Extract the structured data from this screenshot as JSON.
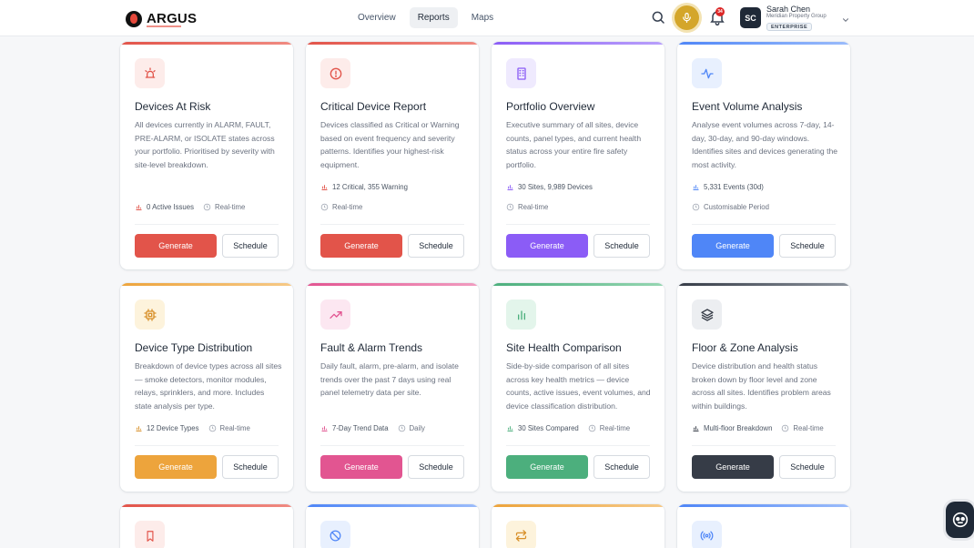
{
  "header": {
    "logo_text": "ARGUS",
    "nav": [
      {
        "label": "Overview",
        "active": false
      },
      {
        "label": "Reports",
        "active": true
      },
      {
        "label": "Maps",
        "active": false
      }
    ],
    "notifications_count": "34",
    "user": {
      "initials": "SC",
      "name": "Sarah Chen",
      "org": "Meridian Property Group",
      "tier": "ENTERPRISE"
    }
  },
  "colors": {
    "red": "#e2544a",
    "purple": "#8b5cf6",
    "blue": "#4f86f7",
    "amber": "#eda43c",
    "pink": "#e25591",
    "green": "#4caf7d",
    "dark": "#363c47"
  },
  "cards": [
    {
      "title": "Devices At Risk",
      "desc": "All devices currently in ALARM, FAULT, PRE-ALARM, or ISOLATE states across your portfolio. Prioritised by severity with site-level breakdown.",
      "meta1": "0 Active Issues",
      "meta2": "Real-time",
      "generate": "Generate",
      "schedule": "Schedule",
      "icon": "alarm-siren-icon",
      "accent": "#e2544a"
    },
    {
      "title": "Critical Device Report",
      "desc": "Devices classified as Critical or Warning based on event frequency and severity patterns. Identifies your highest-risk equipment.",
      "meta1": "12 Critical, 355 Warning",
      "meta2": "Real-time",
      "generate": "Generate",
      "schedule": "Schedule",
      "icon": "alert-circle-icon",
      "accent": "#e2544a"
    },
    {
      "title": "Portfolio Overview",
      "desc": "Executive summary of all sites, device counts, panel types, and current health status across your entire fire safety portfolio.",
      "meta1": "30 Sites, 9,989 Devices",
      "meta2": "Real-time",
      "generate": "Generate",
      "schedule": "Schedule",
      "icon": "building-icon",
      "accent": "#8b5cf6"
    },
    {
      "title": "Event Volume Analysis",
      "desc": "Analyse event volumes across 7-day, 14-day, 30-day, and 90-day windows. Identifies sites and devices generating the most activity.",
      "meta1": "5,331 Events (30d)",
      "meta2": "Customisable Period",
      "generate": "Generate",
      "schedule": "Schedule",
      "icon": "activity-icon",
      "accent": "#4f86f7"
    },
    {
      "title": "Device Type Distribution",
      "desc": "Breakdown of device types across all sites — smoke detectors, monitor modules, relays, sprinklers, and more. Includes state analysis per type.",
      "meta1": "12 Device Types",
      "meta2": "Real-time",
      "generate": "Generate",
      "schedule": "Schedule",
      "icon": "cpu-chip-icon",
      "accent": "#eda43c"
    },
    {
      "title": "Fault & Alarm Trends",
      "desc": "Daily fault, alarm, pre-alarm, and isolate trends over the past 7 days using real panel telemetry data per site.",
      "meta1": "7-Day Trend Data",
      "meta2": "Daily",
      "generate": "Generate",
      "schedule": "Schedule",
      "icon": "trending-up-icon",
      "accent": "#e25591"
    },
    {
      "title": "Site Health Comparison",
      "desc": "Side-by-side comparison of all sites across key health metrics — device counts, active issues, event volumes, and device classification distribution.",
      "meta1": "30 Sites Compared",
      "meta2": "Real-time",
      "generate": "Generate",
      "schedule": "Schedule",
      "icon": "bar-chart-icon",
      "accent": "#4caf7d"
    },
    {
      "title": "Floor & Zone Analysis",
      "desc": "Device distribution and health status broken down by floor level and zone across all sites. Identifies problem areas within buildings.",
      "meta1": "Multi-floor Breakdown",
      "meta2": "Real-time",
      "generate": "Generate",
      "schedule": "Schedule",
      "icon": "layers-icon",
      "accent": "#363c47"
    },
    {
      "icon": "bookmark-icon",
      "accent": "#e2544a"
    },
    {
      "icon": "ban-icon",
      "accent": "#4f86f7"
    },
    {
      "icon": "repeat-arrows-icon",
      "accent": "#eda43c"
    },
    {
      "icon": "broadcast-icon",
      "accent": "#4f86f7"
    }
  ]
}
